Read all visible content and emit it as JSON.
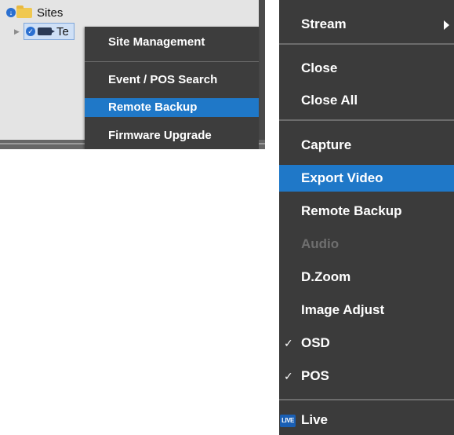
{
  "tree": {
    "root_label": "Sites",
    "site_label": "Te"
  },
  "site_context_menu": {
    "items": [
      {
        "label": "Site Management",
        "highlighted": false
      },
      {
        "label": "Event / POS Search",
        "highlighted": false
      },
      {
        "label": "Remote Backup",
        "highlighted": true
      },
      {
        "label": "Firmware Upgrade",
        "highlighted": false
      }
    ]
  },
  "video_menu": {
    "items": [
      {
        "label": "Stream",
        "has_submenu": true
      },
      {
        "label": "Close"
      },
      {
        "label": "Close All"
      },
      {
        "label": "Capture"
      },
      {
        "label": "Export Video",
        "highlighted": true
      },
      {
        "label": "Remote Backup"
      },
      {
        "label": "Audio",
        "disabled": true
      },
      {
        "label": "D.Zoom"
      },
      {
        "label": "Image Adjust"
      },
      {
        "label": "OSD",
        "checked": true
      },
      {
        "label": "POS",
        "checked": true
      },
      {
        "label": "Live",
        "icon_text": "LIVE"
      }
    ]
  },
  "colors": {
    "menu_background": "#3b3b3b",
    "highlight": "#1f78c8",
    "disabled_text": "#6f6f6f",
    "tree_background": "#e4e4e4"
  }
}
